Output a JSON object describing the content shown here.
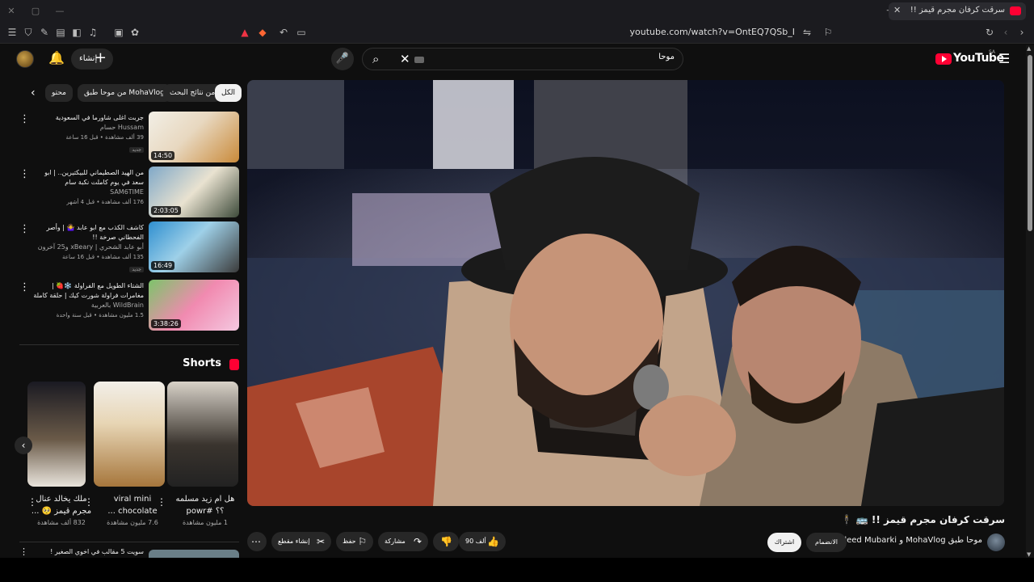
{
  "browser": {
    "tab_title": "سرقت كرفان مجرم قيمز !!",
    "url": "youtube.com/watch?v=OntEQ7QSb_I"
  },
  "header": {
    "logo_text": "YouTube",
    "region": "SA",
    "create_label": "إنشاء",
    "search_value": "موحا"
  },
  "chips": {
    "all": "الكل",
    "search_related": "من نتائج البحث",
    "from_channel": "من موحا طبق MohaVlog",
    "partial": "محتو"
  },
  "recommendations": [
    {
      "title": "جربت اغلى شاورما في السعودية",
      "channel": "Hussam حسام",
      "stats": "39 ألف مشاهدة • قبل 16 ساعة",
      "badge": "جديد",
      "duration": "14:50"
    },
    {
      "title": "من الهيد الصطيماني للبيكتيرين.. | ابو سعد في يوم كاملت نكبة سام",
      "channel": "SAM6TIME",
      "stats": "176 ألف مشاهدة • قبل 4 أشهر",
      "badge": "",
      "duration": "2:03:05"
    },
    {
      "title": "كاشف الكذب مع ابو عابد 🤷‍♀️ | وأصر الفحطاني صرخة !!",
      "channel": "أبو عابد الشحري | xBeary و25 آخرون",
      "stats": "135 ألف مشاهدة • قبل 16 ساعة",
      "badge": "جديد",
      "duration": "16:49"
    },
    {
      "title": "الشتاء الطويل مع الفراولة ❄️🍓 | مغامرات فراولة شورت كيك | حلقة كاملة | ...",
      "channel": "WildBrain بالعربية",
      "stats": "1.5 مليون مشاهدة • قبل سنة واحدة",
      "badge": "",
      "duration": "3:38:26"
    }
  ],
  "shorts": {
    "heading": "Shorts",
    "items": [
      {
        "title": "هل ام زيد مسلمه ؟؟ #powr",
        "views": "1 مليون مشاهدة"
      },
      {
        "title": "viral mini chocolate ...",
        "views": "7.6 مليون مشاهدة"
      },
      {
        "title": "ملك يخالد عنال مجرم قيمز 🥺 ...",
        "views": "832 ألف مشاهدة"
      }
    ]
  },
  "next_row_title": "سويت 5 مقالب في اخوي الصغير !",
  "video": {
    "title": "سرقت كرفان مجرم قيمز !! 🚌 🕴️",
    "channel": "موحا طبق MohaVlog و Waleed Mubarki",
    "join_label": "الانضمام",
    "subscribe_label": "اشتراك",
    "likes": "90 ألف",
    "share_label": "مشاركة",
    "save_label": "حفظ",
    "clip_label": "إنشاء مقطع"
  }
}
